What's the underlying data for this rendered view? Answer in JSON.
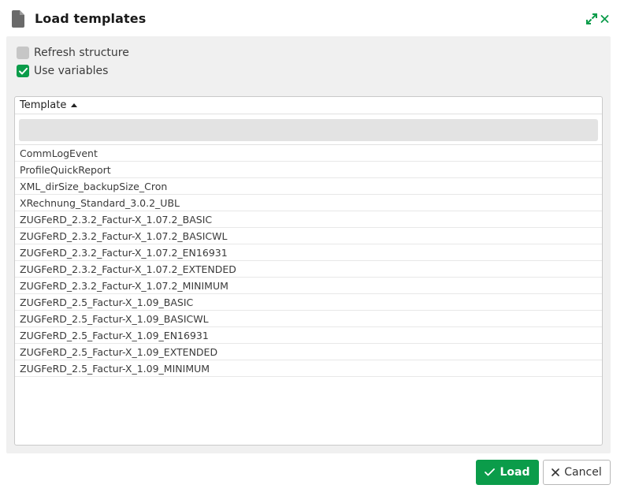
{
  "dialog": {
    "title": "Load templates",
    "icons": {
      "title": "document-icon",
      "expand": "expand-icon",
      "close": "close-icon"
    }
  },
  "options": [
    {
      "label": "Refresh structure",
      "checked": false
    },
    {
      "label": "Use variables",
      "checked": true
    }
  ],
  "grid": {
    "column": "Template",
    "sort": "ascending",
    "filter_value": "",
    "rows": [
      "CommLogEvent",
      "ProfileQuickReport",
      "XML_dirSize_backupSize_Cron",
      "XRechnung_Standard_3.0.2_UBL",
      "ZUGFeRD_2.3.2_Factur-X_1.07.2_BASIC",
      "ZUGFeRD_2.3.2_Factur-X_1.07.2_BASICWL",
      "ZUGFeRD_2.3.2_Factur-X_1.07.2_EN16931",
      "ZUGFeRD_2.3.2_Factur-X_1.07.2_EXTENDED",
      "ZUGFeRD_2.3.2_Factur-X_1.07.2_MINIMUM",
      "ZUGFeRD_2.5_Factur-X_1.09_BASIC",
      "ZUGFeRD_2.5_Factur-X_1.09_BASICWL",
      "ZUGFeRD_2.5_Factur-X_1.09_EN16931",
      "ZUGFeRD_2.5_Factur-X_1.09_EXTENDED",
      "ZUGFeRD_2.5_Factur-X_1.09_MINIMUM"
    ]
  },
  "buttons": {
    "load": "Load",
    "cancel": "Cancel"
  },
  "colors": {
    "accent": "#0b9c4a",
    "panel": "#f0f0f0",
    "filter_bg": "#e3e3e3"
  }
}
